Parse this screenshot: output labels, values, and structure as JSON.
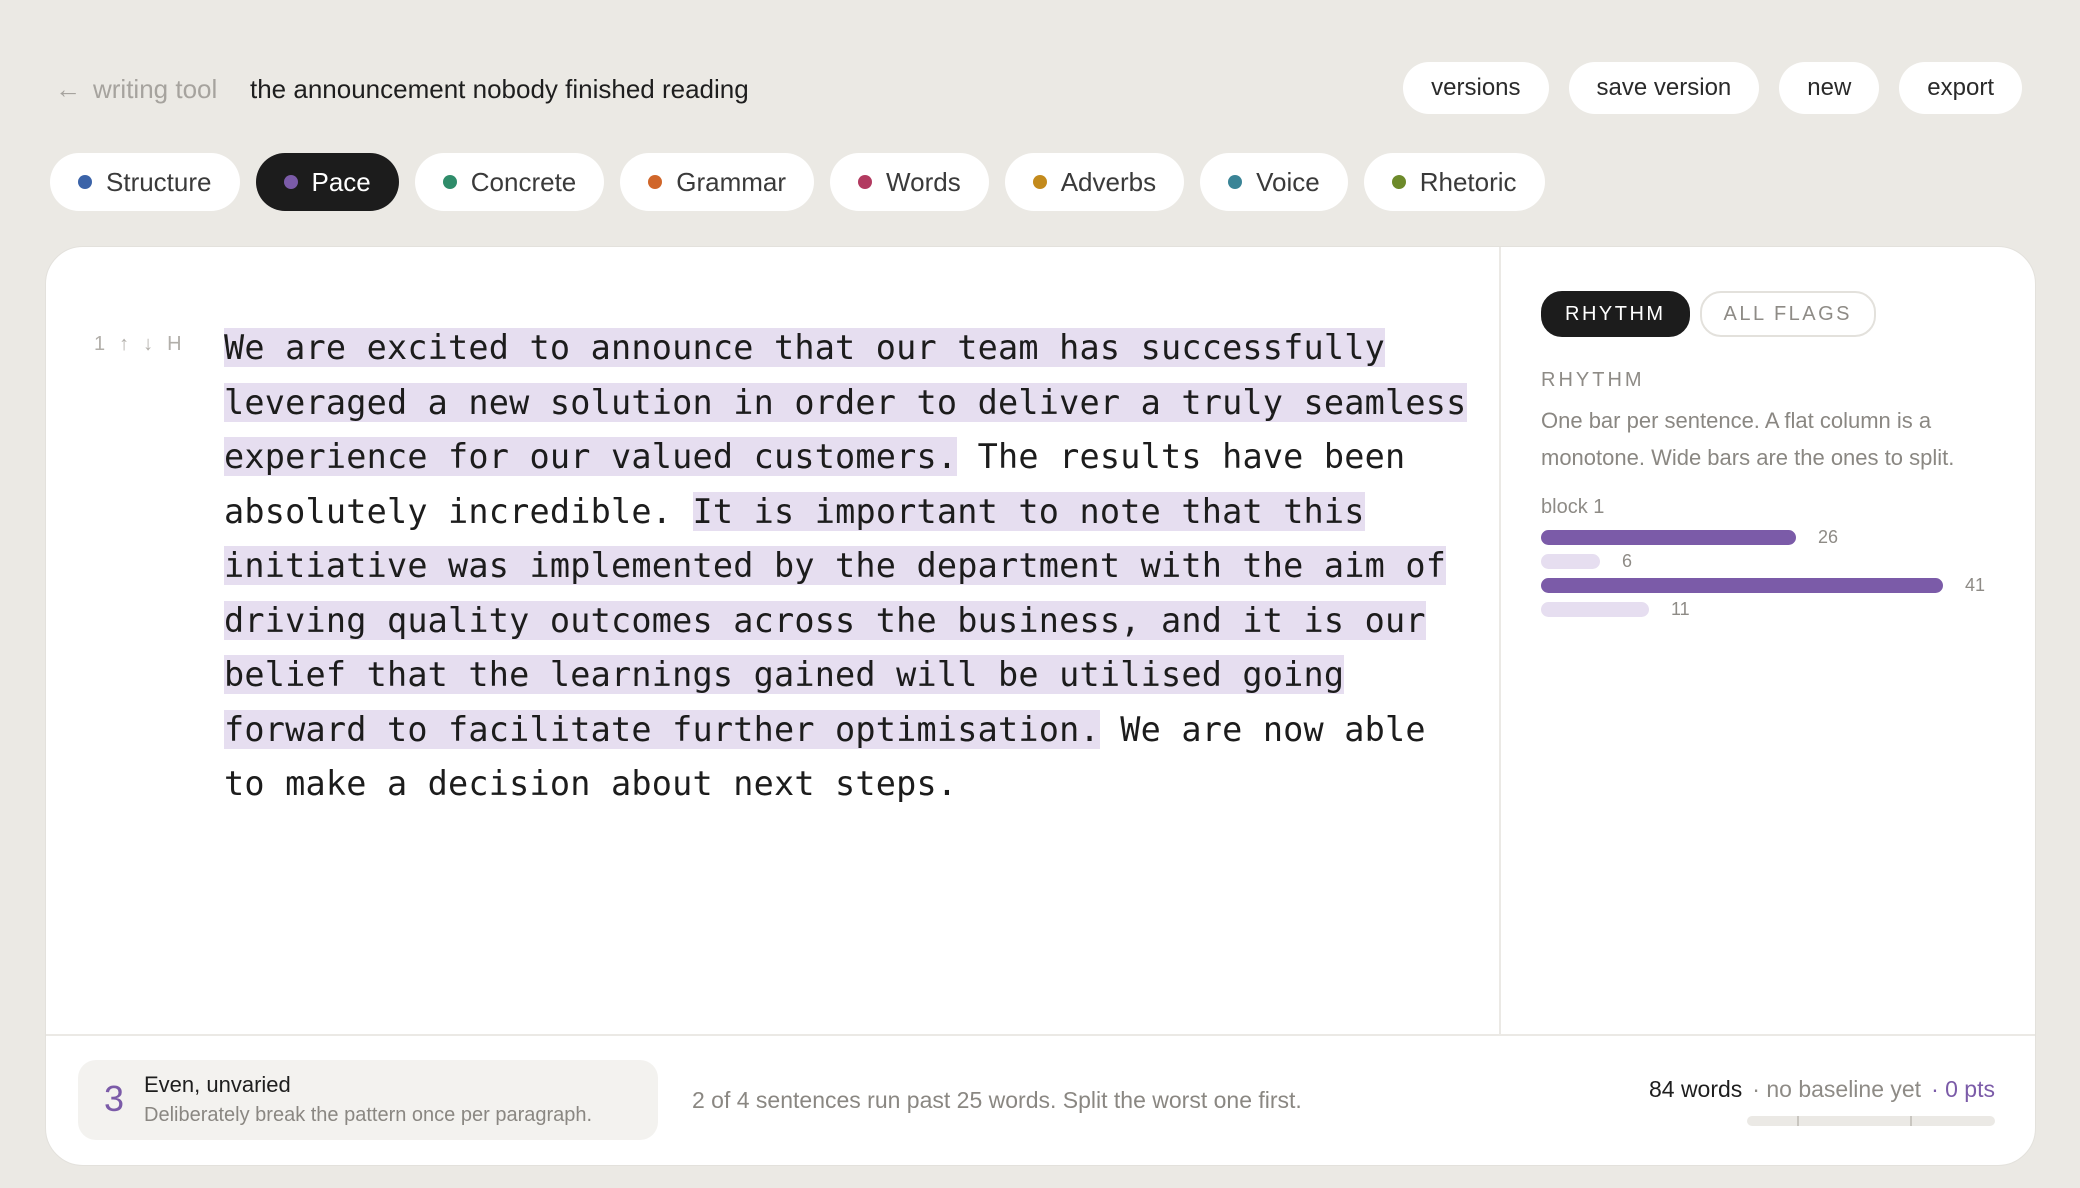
{
  "header": {
    "back_label": "writing tool",
    "back_icon": "arrow-left-icon",
    "doc_title": "the announcement nobody finished reading",
    "actions": [
      "versions",
      "save version",
      "new",
      "export"
    ]
  },
  "tabs": [
    {
      "label": "Structure",
      "color": "#3b63a8"
    },
    {
      "label": "Pace",
      "color": "#7b5ba8",
      "active": true
    },
    {
      "label": "Concrete",
      "color": "#2f8c6a"
    },
    {
      "label": "Grammar",
      "color": "#d0662a"
    },
    {
      "label": "Words",
      "color": "#b23a60"
    },
    {
      "label": "Adverbs",
      "color": "#c38a1c"
    },
    {
      "label": "Voice",
      "color": "#3a8496"
    },
    {
      "label": "Rhetoric",
      "color": "#6d8a2a"
    }
  ],
  "editor": {
    "gutter": {
      "number": "1",
      "up": "↑",
      "down": "↓",
      "heading": "H"
    },
    "sentences": [
      {
        "text": "We are excited to announce that our team has successfully leveraged a new solution in order to deliver a truly seamless experience for our valued customers.",
        "flagged": true
      },
      {
        "text": "The results have been absolutely incredible.",
        "flagged": false
      },
      {
        "text": "It is important to note that this initiative was implemented by the department with the aim of driving quality outcomes across the business, and it is our belief that the learnings gained will be utilised going forward to facilitate further optimisation.",
        "flagged": true
      },
      {
        "text": "We are now able to make a decision about next steps.",
        "flagged": false
      }
    ]
  },
  "sidebar": {
    "tabs": [
      {
        "label": "RHYTHM",
        "active": true
      },
      {
        "label": "ALL FLAGS",
        "active": false
      }
    ],
    "heading": "RHYTHM",
    "description": "One bar per sentence. A flat column is a monotone. Wide bars are the ones to split.",
    "block_label": "block 1",
    "sentence_lengths": [
      26,
      6,
      41,
      11
    ],
    "long_threshold": 25
  },
  "footer": {
    "score": "3",
    "score_title": "Even, unvaried",
    "score_subtitle": "Deliberately break the pattern once per paragraph.",
    "message": "2 of 4 sentences run past 25 words. Split the worst one first.",
    "word_count": "84 words",
    "baseline": "· no baseline yet",
    "points": "· 0 pts"
  },
  "colors": {
    "accent": "#7b5ba8",
    "highlight": "#e6def0",
    "background": "#ebe9e4"
  }
}
